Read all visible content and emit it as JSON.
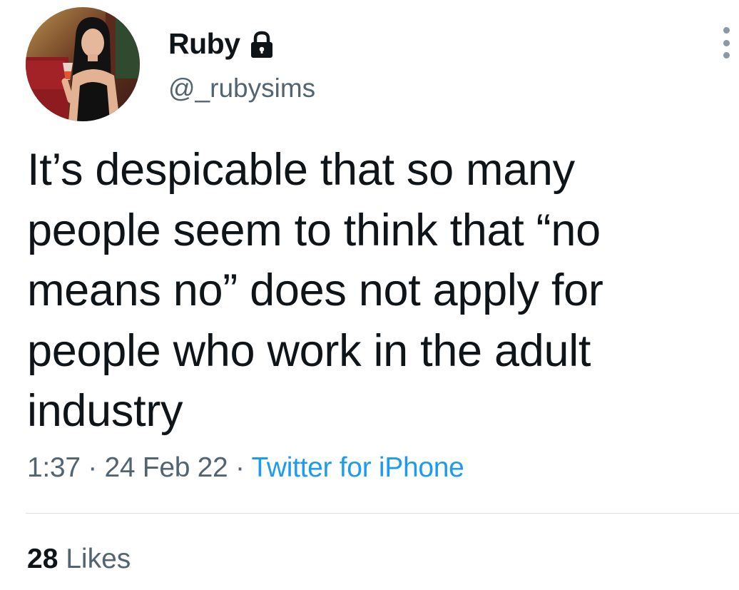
{
  "author": {
    "display_name": "Ruby",
    "handle": "@_rubysims",
    "protected_icon": "lock-icon",
    "avatar_icon": "profile-photo"
  },
  "tweet": {
    "text": "It’s despicable that so many\npeople seem to think that “no\nmeans no” does not apply for\npeople who work in the adult\nindustry",
    "time": "1:37",
    "separator": " · ",
    "date": "24 Feb 22",
    "source": "Twitter for iPhone"
  },
  "stats": {
    "likes_count": "28",
    "likes_label": "Likes"
  },
  "menu": {
    "more_icon": "more-vertical-icon"
  },
  "colors": {
    "text_primary": "#0f1419",
    "text_secondary": "#536471",
    "link": "#1d9bf0",
    "divider": "#dcdfe2"
  }
}
